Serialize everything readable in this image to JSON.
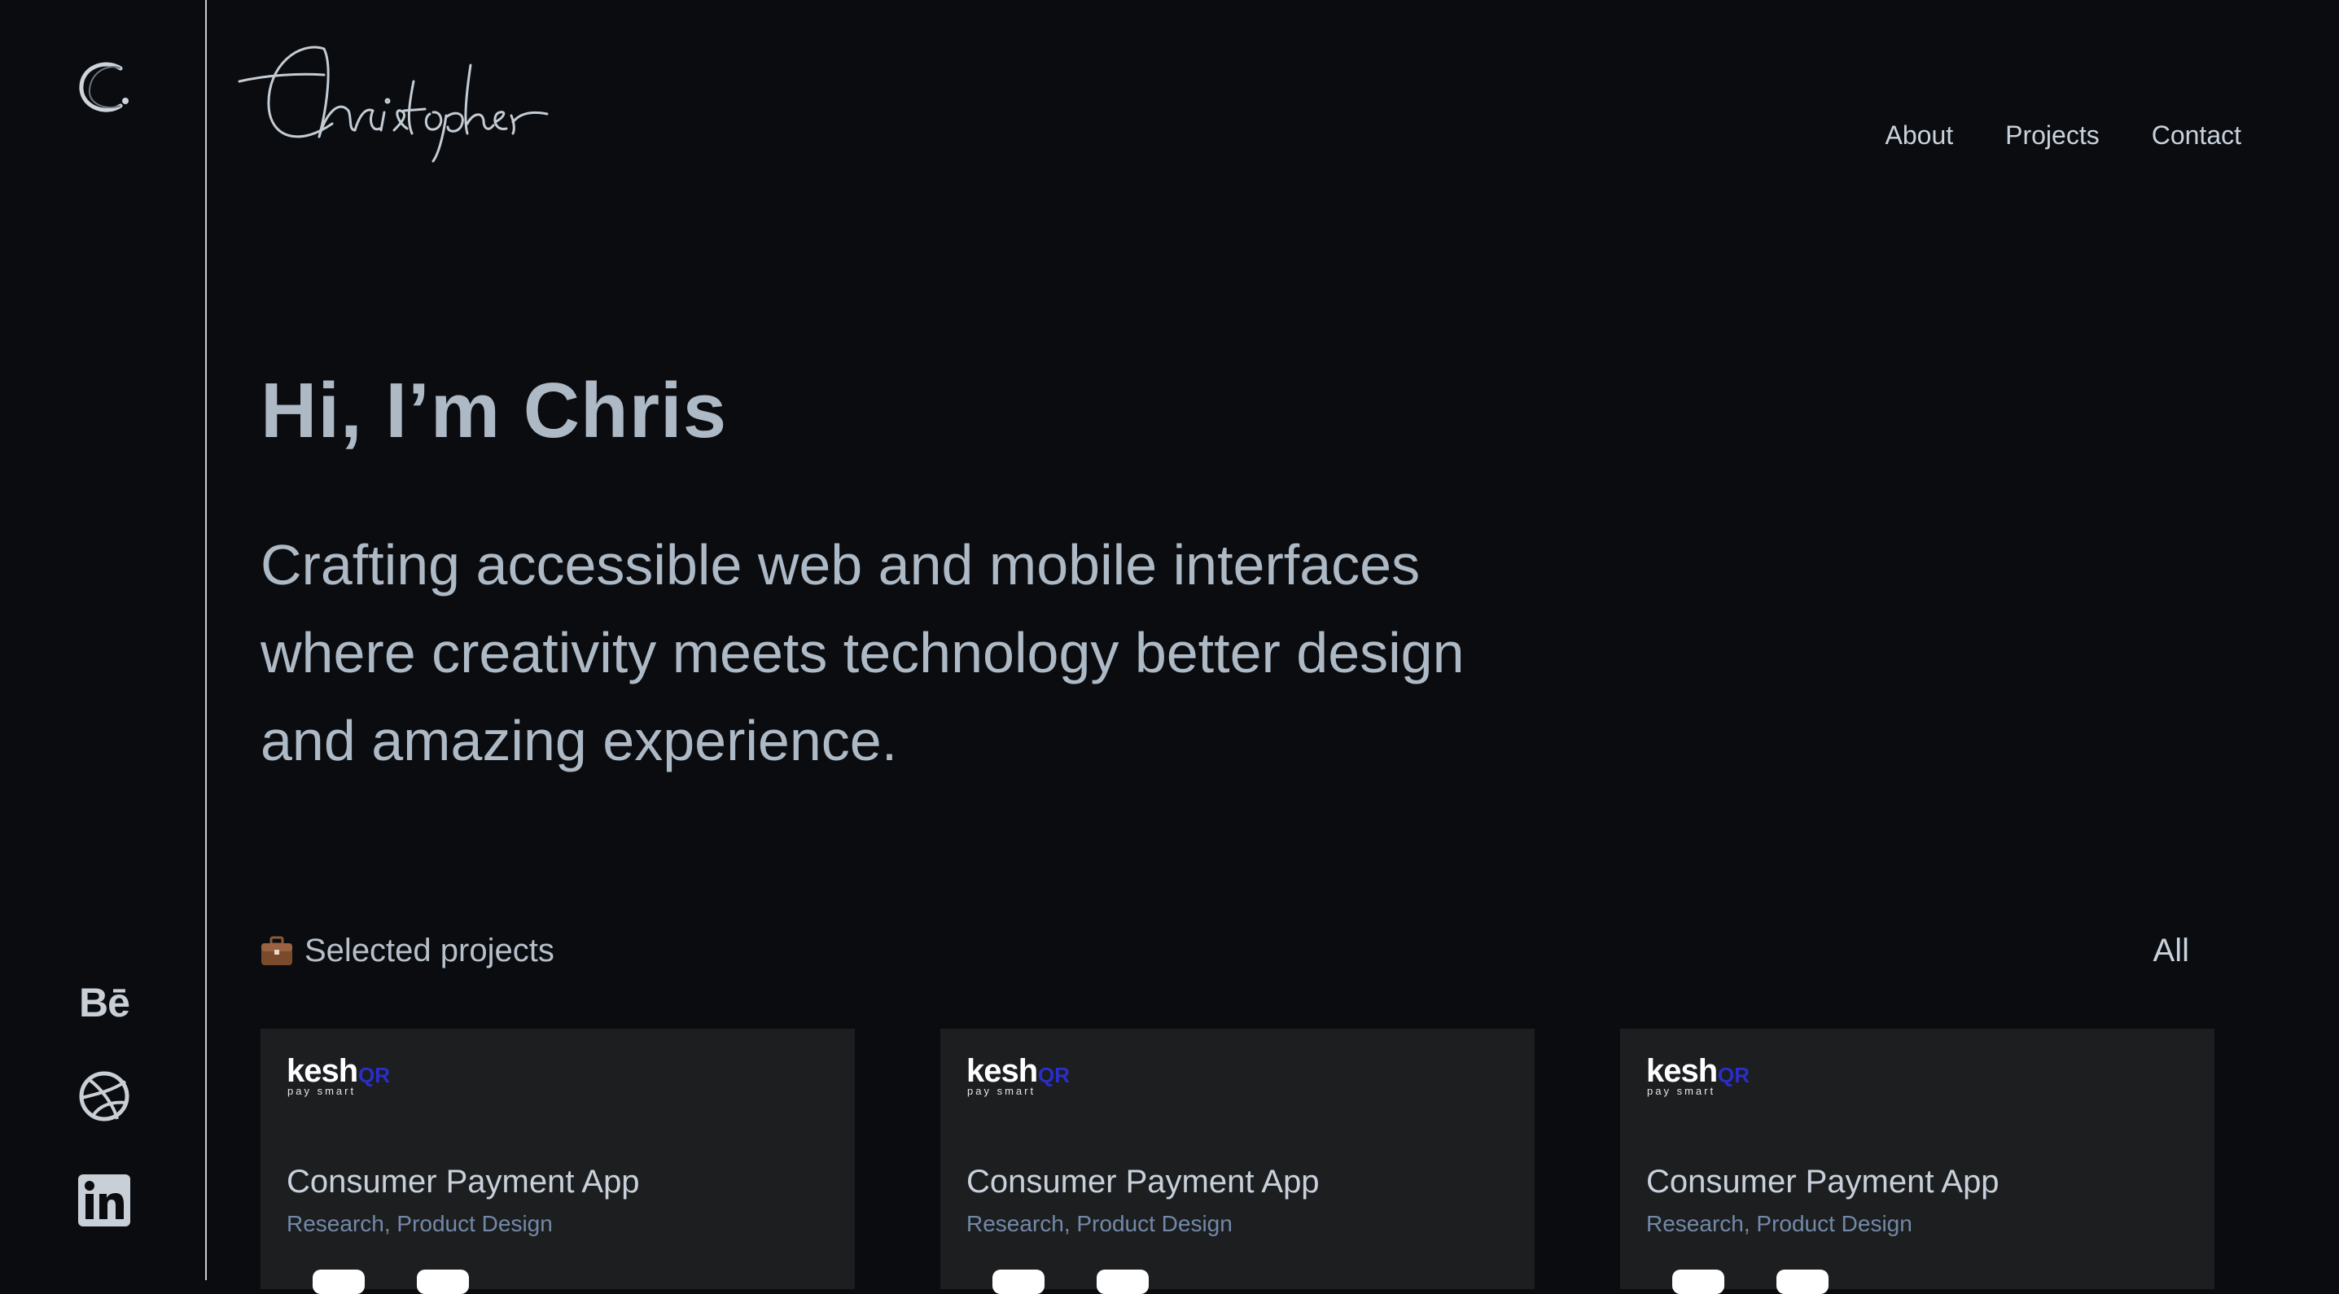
{
  "sidebar": {
    "logo_icon": "c-logo-icon",
    "social": [
      {
        "name": "behance",
        "label": "Bē",
        "icon": "behance-icon"
      },
      {
        "name": "dribbble",
        "icon": "dribbble-icon"
      },
      {
        "name": "linkedin",
        "icon": "linkedin-icon"
      }
    ]
  },
  "header": {
    "signature": "Christopher",
    "nav": [
      "About",
      "Projects",
      "Contact"
    ]
  },
  "hero": {
    "title": "Hi, I’m Chris",
    "subtitle": "Crafting accessible web and mobile interfaces where creativity meets technology better design and amazing experience."
  },
  "projects": {
    "section_label": "Selected projects",
    "section_icon": "briefcase-icon",
    "all_label": "All",
    "cards": [
      {
        "brand": "kesh",
        "brand_suffix": "QR",
        "brand_tag": "pay smart",
        "title": "Consumer Payment App",
        "tags": "Research, Product Design"
      },
      {
        "brand": "kesh",
        "brand_suffix": "QR",
        "brand_tag": "pay smart",
        "title": "Consumer Payment App",
        "tags": "Research, Product Design"
      },
      {
        "brand": "kesh",
        "brand_suffix": "QR",
        "brand_tag": "pay smart",
        "title": "Consumer Payment App",
        "tags": "Research, Product Design"
      }
    ]
  },
  "colors": {
    "background": "#0a0c0f",
    "card": "#1d1e20",
    "text": "#aeb9c6",
    "tag": "#7289a8",
    "brand_accent": "#2a2ec9"
  }
}
